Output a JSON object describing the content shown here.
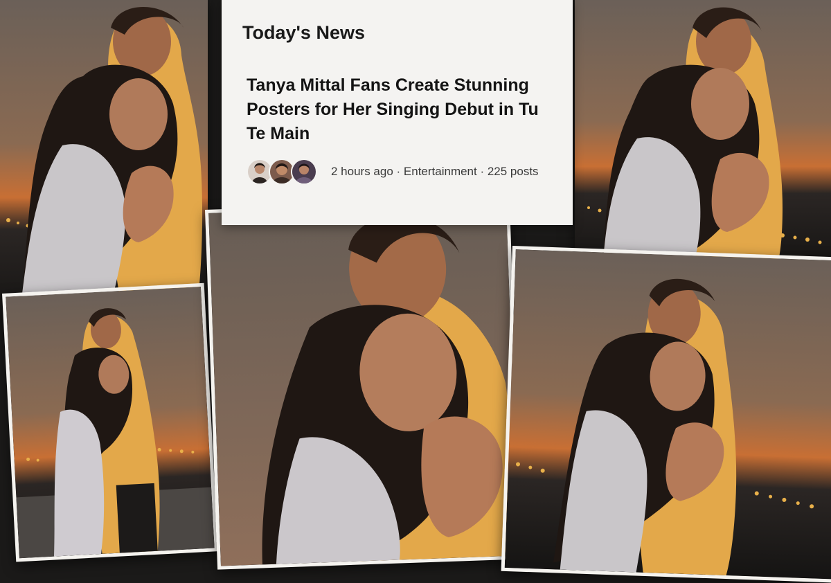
{
  "news_card": {
    "title": "Today's News",
    "headline": "Tanya Mittal Fans Create Stunning Posters for Her Singing Debut in Tu Te Main",
    "meta": "2 hours ago · Entertainment · 225 posts",
    "avatars": [
      "avatar-1",
      "avatar-2",
      "avatar-3"
    ]
  },
  "colors": {
    "card_bg": "#f4f3f1",
    "title_text": "#1a1a1a",
    "meta_text": "#3a3a3a",
    "sunset_orange": "#d6762f"
  },
  "photos": [
    {
      "name": "poster-top-left",
      "subject": "couple embracing at sunset"
    },
    {
      "name": "poster-top-right",
      "subject": "couple embracing at sunset"
    },
    {
      "name": "poster-bottom-left",
      "subject": "couple embracing at sunset"
    },
    {
      "name": "poster-bottom-center",
      "subject": "couple embracing close-up"
    },
    {
      "name": "poster-bottom-right",
      "subject": "couple embracing at sunset"
    }
  ]
}
